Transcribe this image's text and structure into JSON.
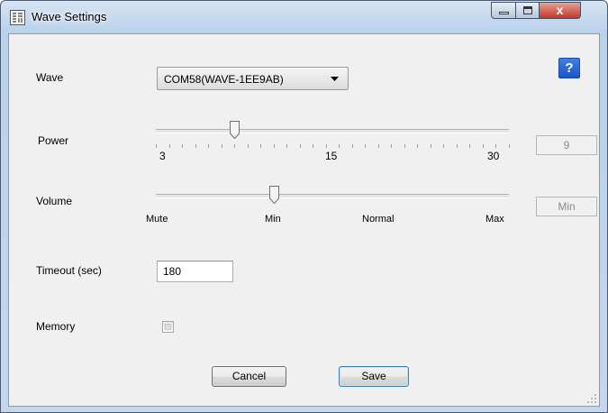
{
  "window": {
    "title": "Wave Settings",
    "close_glyph": "x",
    "colors": {
      "title_bar": "#c5d7ec",
      "close_button": "#c0392b",
      "client": "#f0f0f0"
    }
  },
  "help": {
    "label": "?"
  },
  "wave": {
    "label": "Wave",
    "selected": "COM58(WAVE-1EE9AB)"
  },
  "power": {
    "label": "Power",
    "min_label": "3",
    "mid_label": "15",
    "max_label": "30",
    "min": 3,
    "max": 30,
    "value": 9,
    "display": "9"
  },
  "volume": {
    "label": "Volume",
    "ticks": [
      "Mute",
      "Min",
      "Normal",
      "Max"
    ],
    "value_index": 1,
    "display": "Min"
  },
  "timeout": {
    "label": "Timeout (sec)",
    "value": "180"
  },
  "memory": {
    "label": "Memory",
    "checked": false
  },
  "buttons": {
    "cancel": "Cancel",
    "save": "Save"
  }
}
